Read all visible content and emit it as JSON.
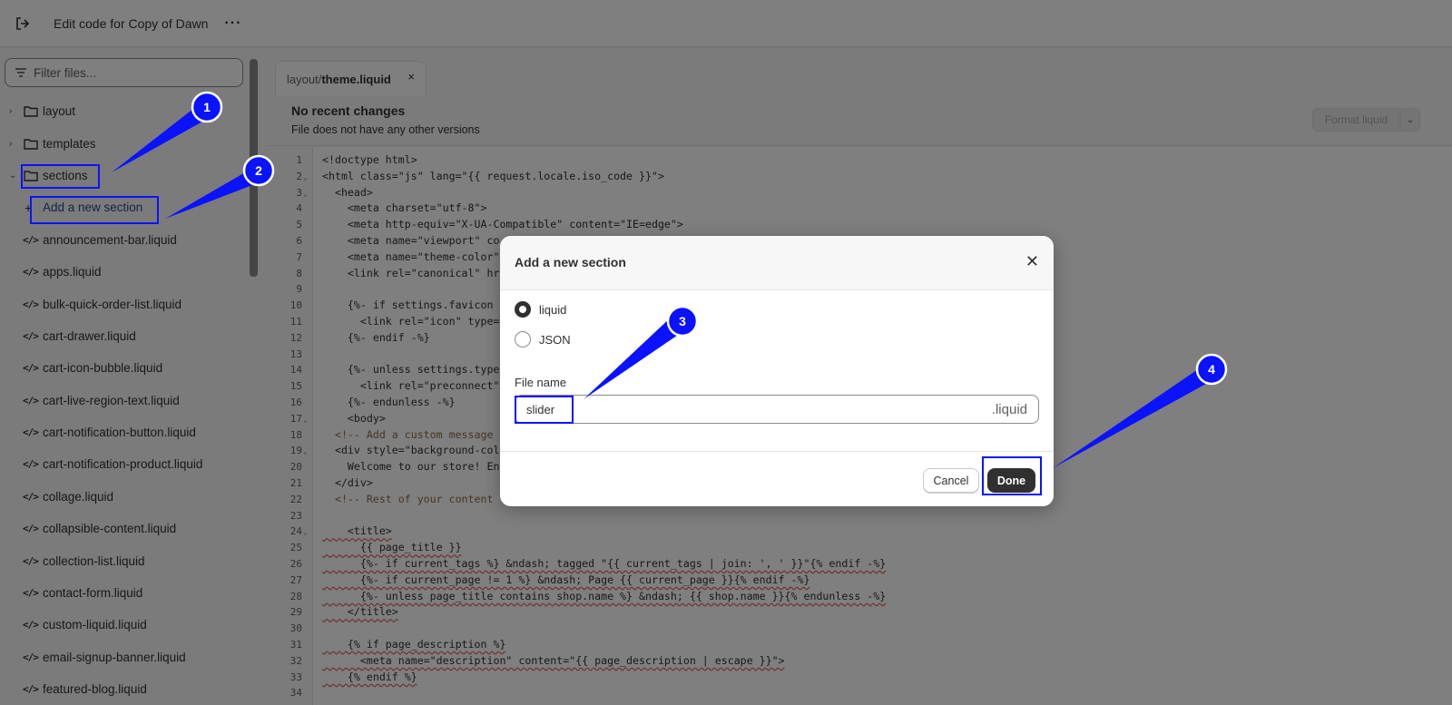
{
  "topbar": {
    "title": "Edit code for Copy of Dawn",
    "more": "···"
  },
  "sidebar": {
    "filter_placeholder": "Filter files...",
    "folders": [
      {
        "label": "layout",
        "chevron": "›"
      },
      {
        "label": "templates",
        "chevron": "›"
      },
      {
        "label": "sections",
        "chevron": "⌄"
      }
    ],
    "add_section": {
      "icon": "+",
      "label": "Add a new section"
    },
    "code_icon": "</>",
    "files": [
      "announcement-bar.liquid",
      "apps.liquid",
      "bulk-quick-order-list.liquid",
      "cart-drawer.liquid",
      "cart-icon-bubble.liquid",
      "cart-live-region-text.liquid",
      "cart-notification-button.liquid",
      "cart-notification-product.liquid",
      "collage.liquid",
      "collapsible-content.liquid",
      "collection-list.liquid",
      "contact-form.liquid",
      "custom-liquid.liquid",
      "email-signup-banner.liquid",
      "featured-blog.liquid"
    ]
  },
  "editor": {
    "tab": {
      "path": "layout/",
      "file": "theme.liquid",
      "close": "×"
    },
    "changes_title": "No recent changes",
    "changes_sub": "File does not have any other versions",
    "format_button": "Format liquid",
    "format_chevron": "⌄",
    "lines": [
      {
        "n": "1",
        "t": "<!doctype html>",
        "k": "attr"
      },
      {
        "n": "2",
        "t": "<html class=\"js\" lang=\"{{ request.locale.iso_code }}\">",
        "k": "attr",
        "fold": true
      },
      {
        "n": "3",
        "t": "  <head>",
        "k": "attr",
        "fold": true
      },
      {
        "n": "4",
        "t": "    <meta charset=\"utf-8\">",
        "k": "attr"
      },
      {
        "n": "5",
        "t": "    <meta http-equiv=\"X-UA-Compatible\" content=\"IE=edge\">",
        "k": "attr"
      },
      {
        "n": "6",
        "t": "    <meta name=\"viewport\" co",
        "k": "attr"
      },
      {
        "n": "7",
        "t": "    <meta name=\"theme-color\"",
        "k": "attr"
      },
      {
        "n": "8",
        "t": "    <link rel=\"canonical\" hr",
        "k": "attr"
      },
      {
        "n": "9",
        "t": "",
        "k": "attr"
      },
      {
        "n": "10",
        "t": "    {%- if settings.favicon",
        "k": "attr"
      },
      {
        "n": "11",
        "t": "      <link rel=\"icon\" type=",
        "k": "attr"
      },
      {
        "n": "12",
        "t": "    {%- endif -%}",
        "k": "attr"
      },
      {
        "n": "13",
        "t": "",
        "k": "attr"
      },
      {
        "n": "14",
        "t": "    {%- unless settings.type",
        "k": "attr"
      },
      {
        "n": "15",
        "t": "      <link rel=\"preconnect\"",
        "k": "attr"
      },
      {
        "n": "16",
        "t": "    {%- endunless -%}",
        "k": "attr"
      },
      {
        "n": "17",
        "t": "    <body>",
        "k": "attr",
        "fold": true
      },
      {
        "n": "18",
        "t": "  <!-- Add a custom message",
        "k": "comment"
      },
      {
        "n": "19",
        "t": "  <div style=\"background-col",
        "k": "attr",
        "fold": true
      },
      {
        "n": "20",
        "t": "    Welcome to our store! En",
        "k": "attr"
      },
      {
        "n": "21",
        "t": "  </div>",
        "k": "attr"
      },
      {
        "n": "22",
        "t": "  <!-- Rest of your content",
        "k": "comment"
      },
      {
        "n": "23",
        "t": "",
        "k": "attr"
      },
      {
        "n": "24",
        "t": "    <title>",
        "k": "liquid",
        "fold": true
      },
      {
        "n": "25",
        "t": "      {{ page_title }}",
        "k": "liquid"
      },
      {
        "n": "26",
        "t": "      {%- if current_tags %} &ndash; tagged \"{{ current_tags | join: ', ' }}\"{% endif -%}",
        "k": "liquid"
      },
      {
        "n": "27",
        "t": "      {%- if current_page != 1 %} &ndash; Page {{ current_page }}{% endif -%}",
        "k": "liquid"
      },
      {
        "n": "28",
        "t": "      {%- unless page_title contains shop.name %} &ndash; {{ shop.name }}{% endunless -%}",
        "k": "liquid"
      },
      {
        "n": "29",
        "t": "    </title>",
        "k": "liquid"
      },
      {
        "n": "30",
        "t": "",
        "k": "attr"
      },
      {
        "n": "31",
        "t": "    {% if page_description %}",
        "k": "liquid"
      },
      {
        "n": "32",
        "t": "      <meta name=\"description\" content=\"{{ page_description | escape }}\">",
        "k": "liquid"
      },
      {
        "n": "33",
        "t": "    {% endif %}",
        "k": "liquid"
      },
      {
        "n": "34",
        "t": "",
        "k": "attr"
      }
    ]
  },
  "modal": {
    "title": "Add a new section",
    "close": "✕",
    "options": [
      {
        "label": "liquid",
        "selected": true
      },
      {
        "label": "JSON",
        "selected": false
      }
    ],
    "file_label": "File name",
    "file_value": "slider",
    "file_suffix": ".liquid",
    "cancel": "Cancel",
    "done": "Done"
  },
  "callouts": [
    "1",
    "2",
    "3",
    "4"
  ],
  "colors": {
    "callout": "#0a12ff",
    "overlay": "rgba(0,0,0,0.5)",
    "done_bg": "#303030"
  }
}
